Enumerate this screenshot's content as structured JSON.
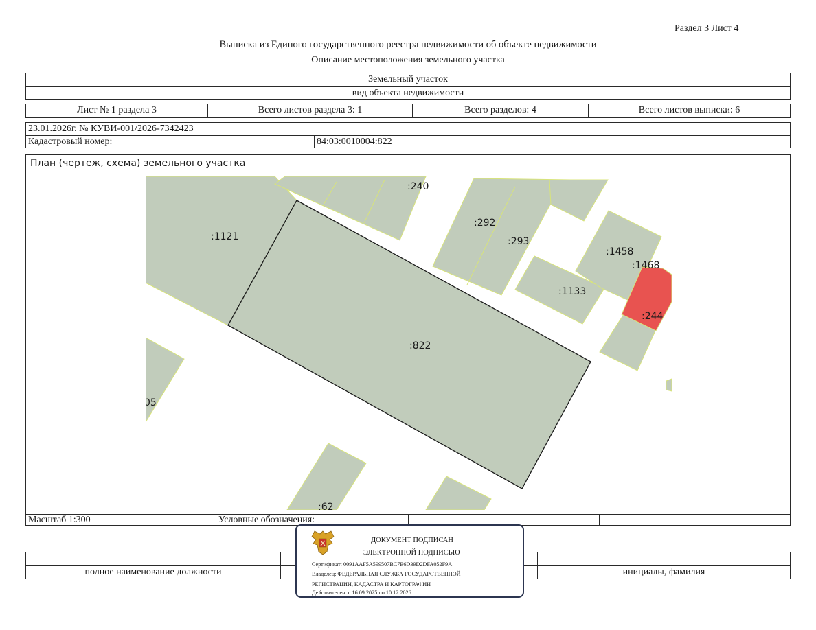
{
  "header": {
    "section_sheet": "Раздел 3    Лист 4",
    "title": "Выписка из Единого государственного реестра недвижимости об объекте недвижимости",
    "subtitle": "Описание местоположения земельного участка"
  },
  "object": {
    "type_value": "Земельный участок",
    "type_caption": "вид объекта недвижимости"
  },
  "sheets": {
    "sheet_no": "Лист № 1 раздела 3",
    "total_section_sheets": "Всего листов раздела 3: 1",
    "total_sections": "Всего разделов: 4",
    "total_extract_sheets": "Всего листов выписки: 6"
  },
  "record": {
    "date_number": "23.01.2026г. № КУВИ-001/2026-7342423",
    "cadastral_label": "Кадастровый номер:",
    "cadastral_value": "84:03:0010004:822"
  },
  "plan": {
    "title": "План (чертеж, схема) земельного участка",
    "parcel_labels": [
      ":240",
      ":1121",
      ":292",
      ":293",
      ":1458",
      ":1468",
      ":1133",
      ":244",
      ":822",
      "05",
      ":62"
    ],
    "colors": {
      "parcel_fill": "#c1ccbb",
      "parcel_border": "#d8e47a",
      "highlight_fill": "#e85350",
      "target_border": "#1a1a1a"
    }
  },
  "legend": {
    "scale": "Масштаб 1:300",
    "conventions_label": "Условные обозначения:"
  },
  "stamp": {
    "line1": "ДОКУМЕНТ ПОДПИСАН",
    "line2": "ЭЛЕКТРОННОЙ ПОДПИСЬЮ",
    "certificate": "Сертификат: 0091AAF5A599507BC7E6D39D2DFA052F9A",
    "owner": "Владелец: ФЕДЕРАЛЬНАЯ СЛУЖБА ГОСУДАРСТВЕННОЙ",
    "owner2": "РЕГИСТРАЦИИ, КАДАСТРА И КАРТОГРАФИИ",
    "valid": "Действителен: с 16.09.2025 по 10.12.2026",
    "emblem_icon": "double-headed-eagle-icon",
    "border_color": "#2c3550"
  },
  "signature": {
    "position_caption": "полное наименование должности",
    "name_caption": "инициалы, фамилия"
  }
}
